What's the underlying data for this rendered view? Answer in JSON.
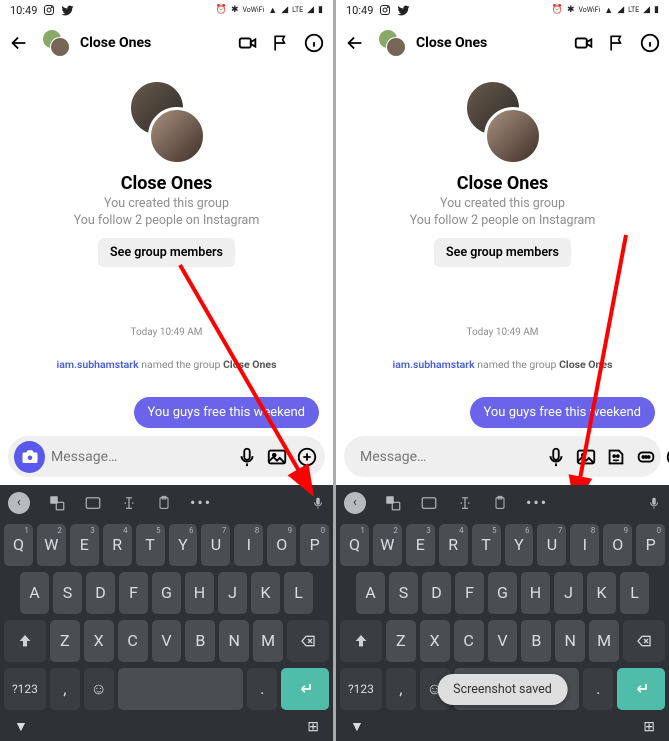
{
  "status": {
    "time": "10:49",
    "lte": "LTE",
    "vowifi": "VoWiFi"
  },
  "header": {
    "title": "Close Ones"
  },
  "group": {
    "name": "Close Ones",
    "line1": "You created this group",
    "line2": "You follow 2 people on Instagram",
    "members_btn": "See group members"
  },
  "thread": {
    "timestamp": "Today 10:49 AM",
    "sys_user": "iam.subhamstark",
    "sys_mid": " named the group ",
    "sys_group": "Close Ones",
    "msg1": "You guys free this weekend"
  },
  "composer": {
    "placeholder": "Message…"
  },
  "keyboard": {
    "row1": [
      "Q",
      "W",
      "E",
      "R",
      "T",
      "Y",
      "U",
      "I",
      "O",
      "P"
    ],
    "row1sup": [
      "1",
      "2",
      "3",
      "4",
      "5",
      "6",
      "7",
      "8",
      "9",
      "0"
    ],
    "row2": [
      "A",
      "S",
      "D",
      "F",
      "G",
      "H",
      "J",
      "K",
      "L"
    ],
    "row3": [
      "Z",
      "X",
      "C",
      "V",
      "B",
      "N",
      "M"
    ],
    "sym": "?123"
  },
  "toast": "Screenshot saved",
  "icons": {
    "instagram": "◻",
    "twitter": "🐦"
  }
}
